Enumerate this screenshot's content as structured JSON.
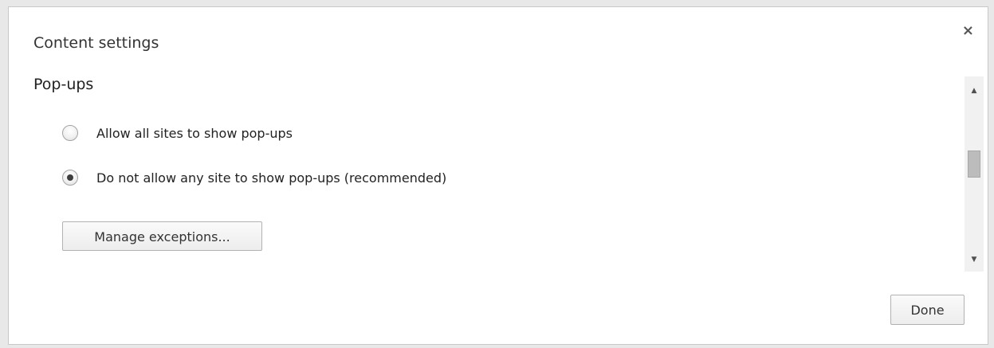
{
  "dialog": {
    "title": "Content settings",
    "close_glyph": "×",
    "close_icon": "close-icon"
  },
  "popups": {
    "heading": "Pop-ups",
    "options": [
      {
        "label": "Allow all sites to show pop-ups",
        "selected": false
      },
      {
        "label": "Do not allow any site to show pop-ups (recommended)",
        "selected": true
      }
    ],
    "manage_label": "Manage exceptions..."
  },
  "scrollbar": {
    "up_glyph": "▲",
    "down_glyph": "▼"
  },
  "footer": {
    "done_label": "Done"
  }
}
